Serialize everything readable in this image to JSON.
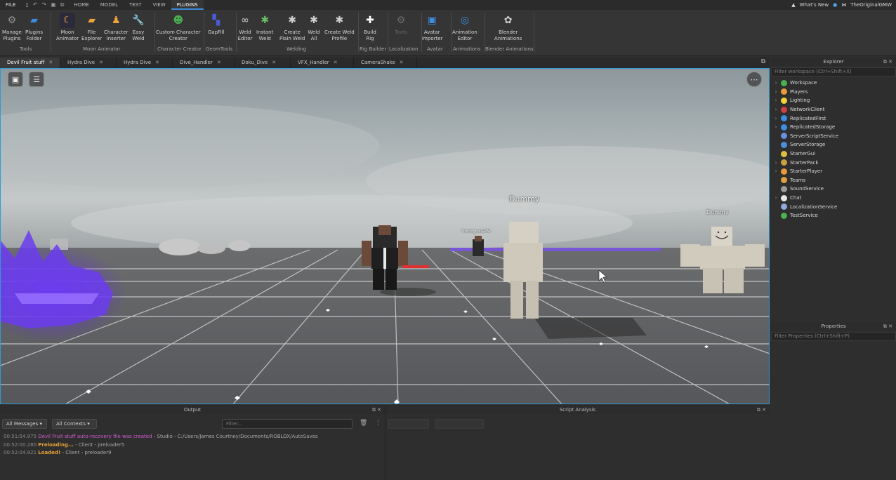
{
  "menubar": {
    "file": "FILE",
    "tabs": [
      "HOME",
      "MODEL",
      "TEST",
      "VIEW",
      "PLUGINS"
    ],
    "active_tab": "PLUGINS",
    "whats_new": "What's New",
    "username": "TheOriginalGMW"
  },
  "ribbon": {
    "buttons": [
      {
        "label1": "Manage",
        "label2": "Plugins",
        "icon": "gear-icon",
        "color": "#8f8f8f"
      },
      {
        "label1": "Plugins",
        "label2": "Folder",
        "icon": "folder-icon",
        "color": "#3c8fe0"
      },
      {
        "label1": "Moon",
        "label2": "Animator",
        "icon": "moon-icon",
        "color": "#e8a33a"
      },
      {
        "label1": "File",
        "label2": "Explorer",
        "icon": "folder-icon",
        "color": "#e8a33a"
      },
      {
        "label1": "Character",
        "label2": "Inserter",
        "icon": "character-icon",
        "color": "#f1a33a"
      },
      {
        "label1": "Easy",
        "label2": "Weld",
        "icon": "wrench-icon",
        "color": "#f0b000"
      },
      {
        "label1": "Custom Character",
        "label2": "Creator",
        "icon": "character-creator-icon",
        "color": "#4caf50"
      },
      {
        "label1": "GapFill",
        "label2": "",
        "icon": "gapfill-icon",
        "color": "#4a5bd6"
      },
      {
        "label1": "Weld",
        "label2": "Editor",
        "icon": "weld-editor-icon",
        "color": "#cfcfcf"
      },
      {
        "label1": "Instant",
        "label2": "Weld",
        "icon": "instant-weld-icon",
        "color": "#6abf69"
      },
      {
        "label1": "Create",
        "label2": "Plain Weld",
        "icon": "plain-weld-icon",
        "color": "#cfcfcf"
      },
      {
        "label1": "Weld",
        "label2": "All",
        "icon": "weld-all-icon",
        "color": "#cfcfcf"
      },
      {
        "label1": "Create Weld",
        "label2": "Profile",
        "icon": "weld-profile-icon",
        "color": "#cfcfcf"
      },
      {
        "label1": "Build",
        "label2": "Rig",
        "icon": "build-rig-icon",
        "color": "#ffffff"
      },
      {
        "label1": "Tools",
        "label2": "",
        "icon": "localization-tools-icon",
        "color": "#6a6a6a"
      },
      {
        "label1": "Avatar",
        "label2": "Importer",
        "icon": "avatar-importer-icon",
        "color": "#3c8fe0"
      },
      {
        "label1": "Animation",
        "label2": "Editor",
        "icon": "animation-editor-icon",
        "color": "#3c8fe0"
      },
      {
        "label1": "Blender",
        "label2": "Animations",
        "icon": "blender-icon",
        "color": "#cfcfcf"
      }
    ],
    "groups": [
      "Tools",
      "Moon Animator",
      "Character Creator",
      "GeomTools",
      "Welding",
      "Rig Builder",
      "Localization",
      "Avatar",
      "Animations",
      "Blender Animations"
    ]
  },
  "doctabs": [
    "Devil Fruit stuff",
    "Hydra Dive",
    "Hydra Dive",
    "Dive_Handler",
    "Doku_Dive",
    "VFX_Handler",
    "CameraShake"
  ],
  "viewport": {
    "nametag_dummy_center": "Dummy",
    "nametag_dummy_right": "Dummy",
    "nametag_player": "TheOriginalGMW"
  },
  "explorer": {
    "title": "Explorer",
    "filter_placeholder": "Filter workspace (Ctrl+Shift+X)",
    "items": [
      {
        "name": "Workspace",
        "expand": true,
        "color": "#4caf50"
      },
      {
        "name": "Players",
        "expand": true,
        "color": "#e89a3a"
      },
      {
        "name": "Lighting",
        "expand": true,
        "color": "#f3d23a"
      },
      {
        "name": "NetworkClient",
        "expand": true,
        "color": "#d04040"
      },
      {
        "name": "ReplicatedFirst",
        "expand": true,
        "color": "#3c8fe0"
      },
      {
        "name": "ReplicatedStorage",
        "expand": true,
        "color": "#3c8fe0"
      },
      {
        "name": "ServerScriptService",
        "expand": false,
        "color": "#6a8fe0"
      },
      {
        "name": "ServerStorage",
        "expand": false,
        "color": "#4a90d9"
      },
      {
        "name": "StarterGui",
        "expand": false,
        "color": "#e0c040"
      },
      {
        "name": "StarterPack",
        "expand": true,
        "color": "#c8a040"
      },
      {
        "name": "StarterPlayer",
        "expand": true,
        "color": "#e89a3a"
      },
      {
        "name": "Teams",
        "expand": false,
        "color": "#e0a040"
      },
      {
        "name": "SoundService",
        "expand": false,
        "color": "#9a9a9a"
      },
      {
        "name": "Chat",
        "expand": true,
        "color": "#e8e8e8"
      },
      {
        "name": "LocalizationService",
        "expand": false,
        "color": "#8fa8d8"
      },
      {
        "name": "TestService",
        "expand": false,
        "color": "#4caf50"
      }
    ]
  },
  "properties": {
    "title": "Properties",
    "filter_placeholder": "Filter Properties (Ctrl+Shift+P)"
  },
  "output": {
    "title": "Output",
    "messages_dd": "All Messages",
    "contexts_dd": "All Contexts",
    "filter_placeholder": "Filter...",
    "logs": [
      {
        "time": "00:51:54.975",
        "msg": "Devil Fruit stuff auto-recovery file was created",
        "rest": " - Studio - C:/Users/James Courtney/Documents/ROBLOX/AutoSaves",
        "color": "#d15ad1"
      },
      {
        "time": "00:52:00.280",
        "msg": "Preloading...",
        "rest": " - Client - preloader5",
        "color": "#e8a23a"
      },
      {
        "time": "00:52:04.921",
        "msg": "Loaded!",
        "rest": " - Client - preloader9",
        "color": "#e8a23a"
      }
    ]
  },
  "analysis": {
    "title": "Script Analysis"
  }
}
